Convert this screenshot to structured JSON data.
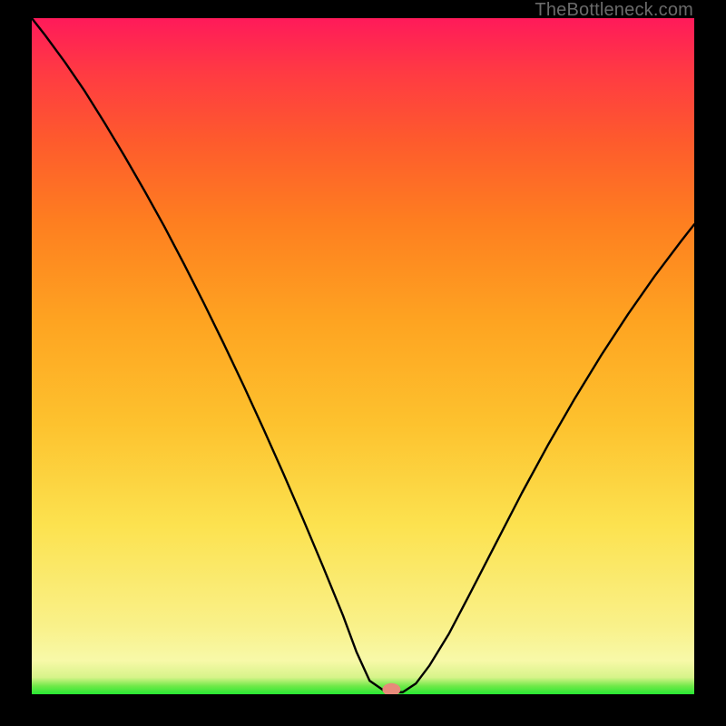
{
  "watermark": "TheBottleneck.com",
  "chart_data": {
    "type": "line",
    "title": "",
    "xlabel": "",
    "ylabel": "",
    "xlim": [
      0,
      100
    ],
    "ylim": [
      0,
      100
    ],
    "grid": false,
    "legend": false,
    "series": [
      {
        "name": "bottleneck-curve",
        "x": [
          0,
          2,
          5,
          8,
          11,
          14,
          17,
          20,
          23,
          26,
          29,
          32,
          35,
          38,
          41,
          44,
          47,
          49,
          51,
          53.5,
          56,
          58,
          60,
          63,
          66,
          70,
          74,
          78,
          82,
          86,
          90,
          94,
          98,
          100
        ],
        "y": [
          100,
          97.5,
          93.5,
          89.2,
          84.5,
          79.6,
          74.5,
          69.2,
          63.6,
          57.8,
          51.8,
          45.6,
          39.2,
          32.6,
          25.8,
          18.8,
          11.6,
          6.3,
          2.0,
          0.3,
          0.3,
          1.6,
          4.2,
          9.0,
          14.6,
          22.2,
          29.8,
          37.0,
          43.8,
          50.2,
          56.2,
          61.8,
          67.0,
          69.5
        ]
      }
    ],
    "marker": {
      "x": 54.3,
      "y": 0.7,
      "color": "#e88a7a"
    },
    "colors": {
      "curve": "#000000",
      "gradient_top": "#ff1a5a",
      "gradient_bottom": "#27e833"
    }
  }
}
